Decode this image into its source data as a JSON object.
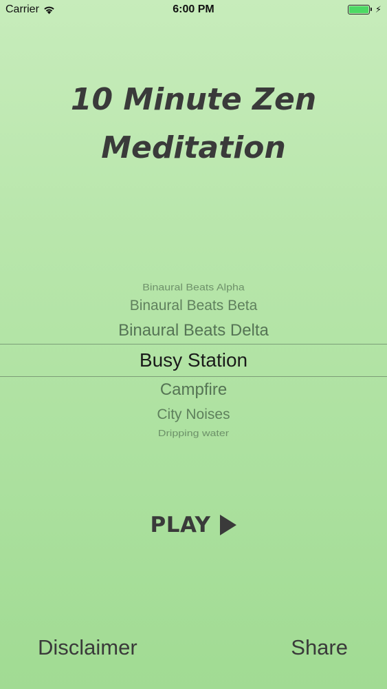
{
  "status_bar": {
    "carrier": "Carrier",
    "time": "6:00 PM",
    "battery_level": 1.0,
    "battery_color": "#4cd964",
    "icons": [
      "wifi-icon",
      "battery-icon",
      "charging-bolt-icon"
    ]
  },
  "title": {
    "line1": "10 Minute Zen",
    "line2": "Meditation"
  },
  "picker": {
    "selected_index": 4,
    "items": [
      "",
      "Binaural Beats Alpha",
      "Binaural Beats Beta",
      "Binaural Beats Delta",
      "Busy Station",
      "Campfire",
      "City Noises",
      "Dripping water",
      ""
    ]
  },
  "play": {
    "label": "PLAY",
    "icon": "play-triangle-icon"
  },
  "footer": {
    "disclaimer_label": "Disclaimer",
    "share_label": "Share"
  },
  "colors": {
    "background_top": "#c7ecbb",
    "background_bottom": "#a1db93",
    "text": "#3a3a3a"
  }
}
